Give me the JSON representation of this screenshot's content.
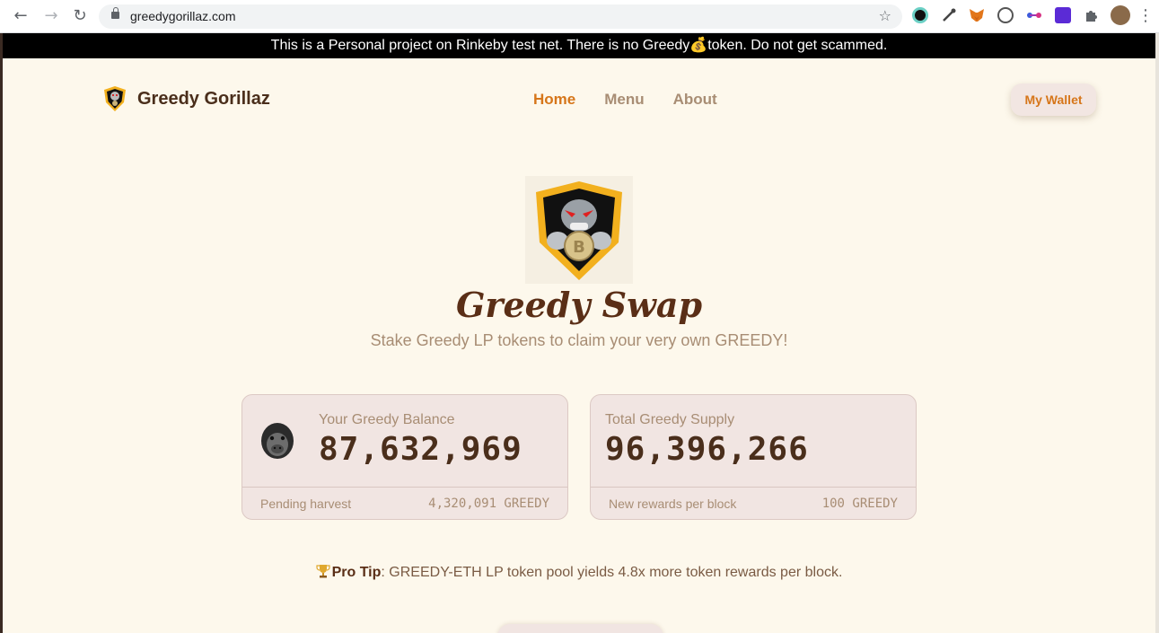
{
  "browser": {
    "url": "greedygorillaz.com"
  },
  "banner": {
    "text_before": "This is a Personal project on Rinkeby test net. There is no Greedy",
    "emoji": "💰",
    "text_after": "token. Do not get scammed."
  },
  "header": {
    "brand": "Greedy Gorillaz",
    "nav": [
      {
        "label": "Home",
        "active": true
      },
      {
        "label": "Menu",
        "active": false
      },
      {
        "label": "About",
        "active": false
      }
    ],
    "wallet_label": "My Wallet"
  },
  "hero": {
    "title": "Greedy Swap",
    "subtitle": "Stake Greedy LP tokens to claim your very own GREEDY!"
  },
  "cards": {
    "balance": {
      "label": "Your Greedy Balance",
      "value": "87,632,969",
      "footer_label": "Pending harvest",
      "footer_value": "4,320,091 GREEDY"
    },
    "supply": {
      "label": "Total Greedy Supply",
      "value": "96,396,266",
      "footer_label": "New rewards per block",
      "footer_value": "100 GREEDY"
    }
  },
  "protip": {
    "label": "Pro Tip",
    "text": ": GREEDY-ETH LP token pool yields 4.8x more token rewards per block."
  },
  "colors": {
    "accent": "#d6761a",
    "brown": "#4a2e1b",
    "background": "#fdf8ec",
    "card": "#f1e5e2"
  }
}
